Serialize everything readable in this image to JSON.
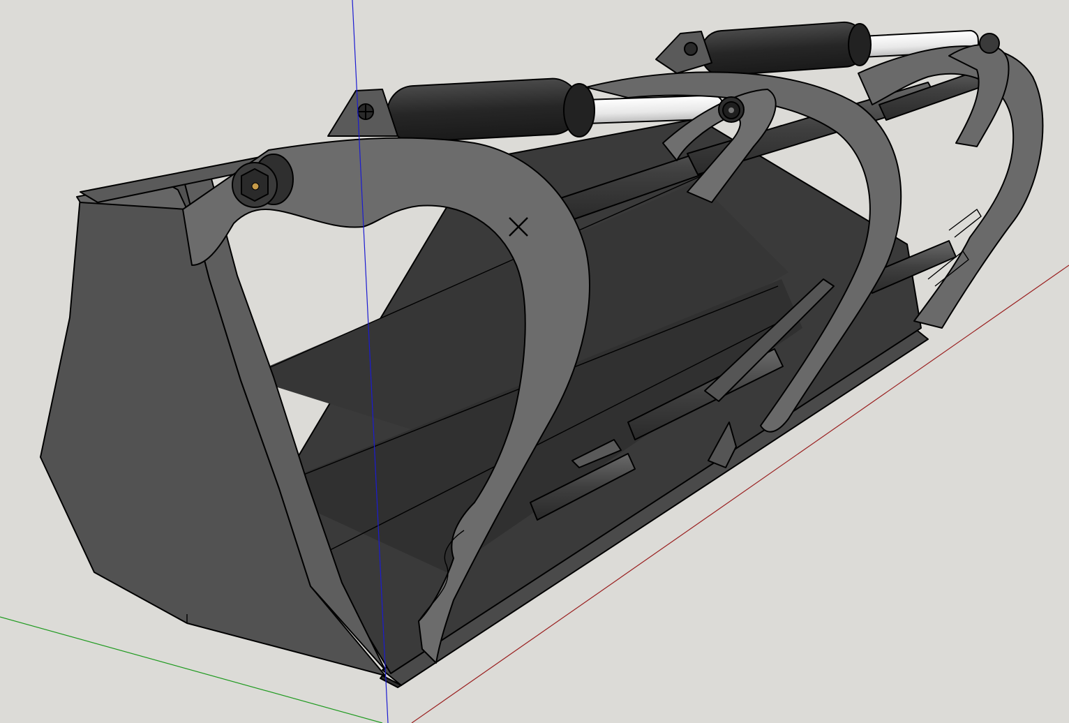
{
  "viewport": {
    "background": "#dcdbd7",
    "axis_colors": {
      "blue_axis": "#1b1bd1",
      "red_axis": "#9a2020",
      "green_axis": "#1f9a1f"
    }
  },
  "model": {
    "subject": "grapple-bucket",
    "colors": {
      "plate_light": "#6e6e6e",
      "plate_mid": "#595959",
      "plate_dark": "#3d3d3d",
      "interior": "#333333",
      "cylinder_body": "#2b2b2b",
      "piston_rod": "#f2f2f2",
      "edge": "#000000"
    }
  }
}
